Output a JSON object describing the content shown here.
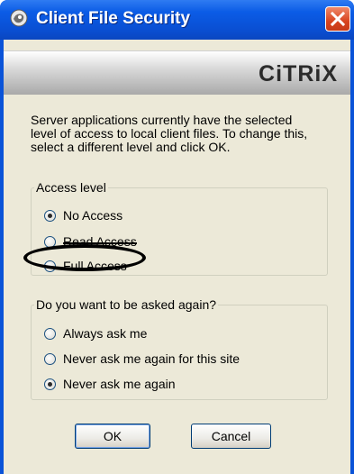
{
  "window": {
    "title": "Client File Security",
    "brand": "CiTRiX"
  },
  "intro_text": "Server applications currently have the selected level of access to local client files. To change this, select a different level and click OK.",
  "access_level": {
    "legend": "Access level",
    "options": [
      {
        "label": "No Access",
        "selected": true
      },
      {
        "label": "Read Access",
        "selected": false
      },
      {
        "label": "Full Access",
        "selected": false
      }
    ]
  },
  "ask_again": {
    "legend": "Do you want to be asked again?",
    "options": [
      {
        "label": "Always ask me",
        "selected": false
      },
      {
        "label": "Never ask me again for this site",
        "selected": false
      },
      {
        "label": "Never ask me again",
        "selected": true
      }
    ]
  },
  "buttons": {
    "ok": "OK",
    "cancel": "Cancel"
  },
  "colors": {
    "titlebar": "#0a53d8",
    "client_bg": "#ece9d8",
    "close_button": "#d8441f"
  }
}
